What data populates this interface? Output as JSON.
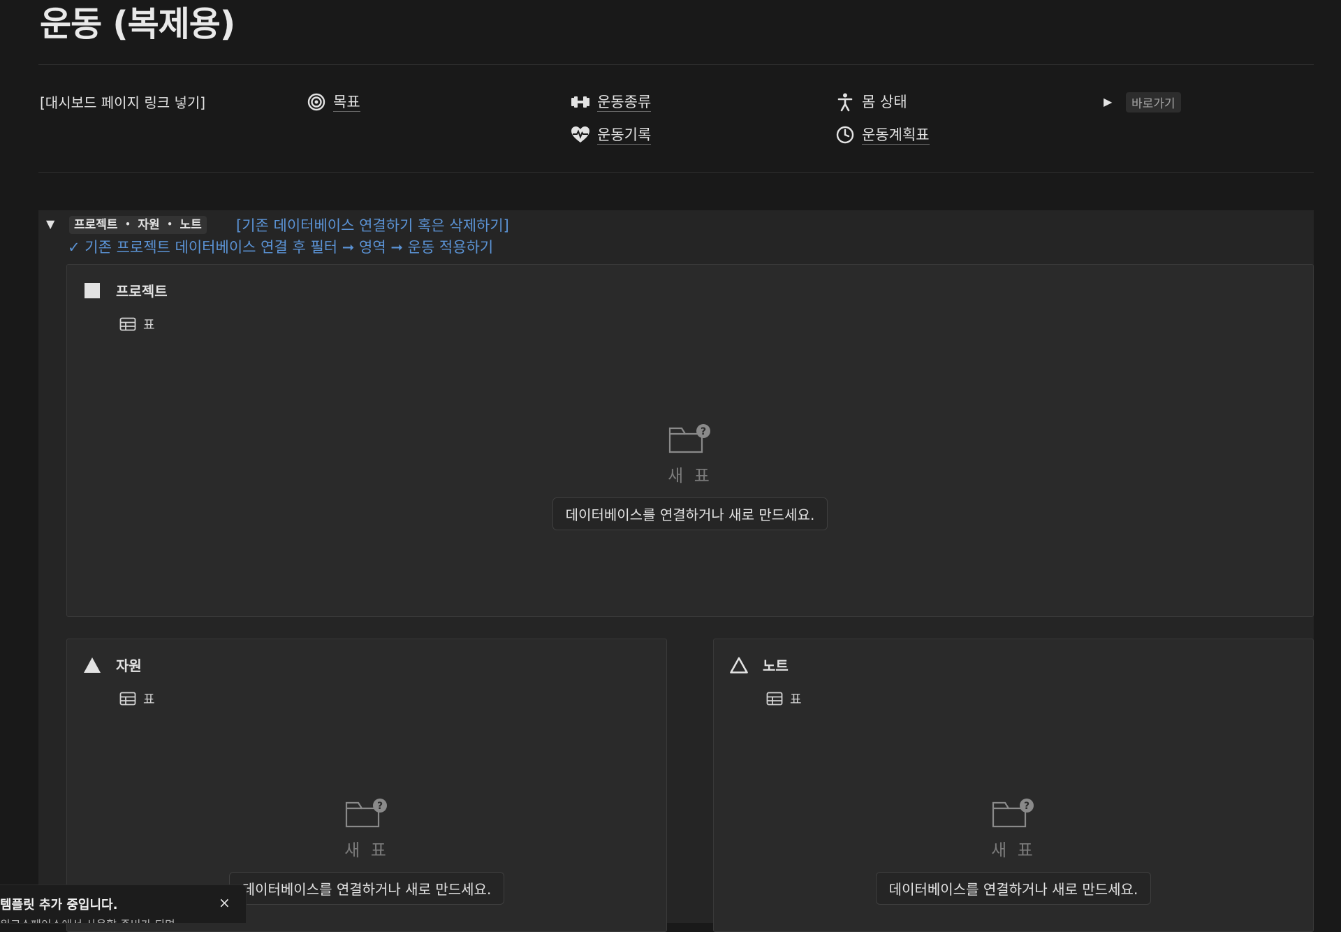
{
  "page": {
    "title": "운동 (복제용)"
  },
  "header_row": {
    "dashboard_link": "[대시보드 페이지 링크 넣기]",
    "items": [
      {
        "label": "목표",
        "icon": "target-icon"
      },
      {
        "label": "운동종류",
        "icon": "dumbbell-icon"
      },
      {
        "label": "몸 상태",
        "icon": "person-icon"
      },
      {
        "label": "운동기록",
        "icon": "heartbeat-icon"
      },
      {
        "label": "운동계획표",
        "icon": "clock-icon"
      }
    ],
    "shortcut_label": "바로가기"
  },
  "callout": {
    "chip": "프로젝트 ・ 자원 ・ 노트",
    "link1": "[기존 데이터베이스 연결하기 혹은 삭제하기]",
    "link2": "✓ 기존 프로젝트 데이터베이스 연결 후 필터 ➞ 영역 ➞ 운동 적용하기"
  },
  "databases": [
    {
      "title": "프로젝트",
      "icon": "square-icon",
      "tab": "표",
      "empty_title": "새 표",
      "empty_button": "데이터베이스를 연결하거나 새로 만드세요."
    },
    {
      "title": "자원",
      "icon": "filled-triangle-icon",
      "tab": "표",
      "empty_title": "새 표",
      "empty_button": "데이터베이스를 연결하거나 새로 만드세요."
    },
    {
      "title": "노트",
      "icon": "outline-triangle-icon",
      "tab": "표",
      "empty_title": "새 표",
      "empty_button": "데이터베이스를 연결하거나 새로 만드세요."
    }
  ],
  "toast": {
    "title": "템플릿 추가 중입니다.",
    "message": "워크스페이스에서 사용할 준비가 되면",
    "close": "×"
  },
  "colors": {
    "background": "#191919",
    "callout": "#252525",
    "link": "#5b93d5"
  }
}
